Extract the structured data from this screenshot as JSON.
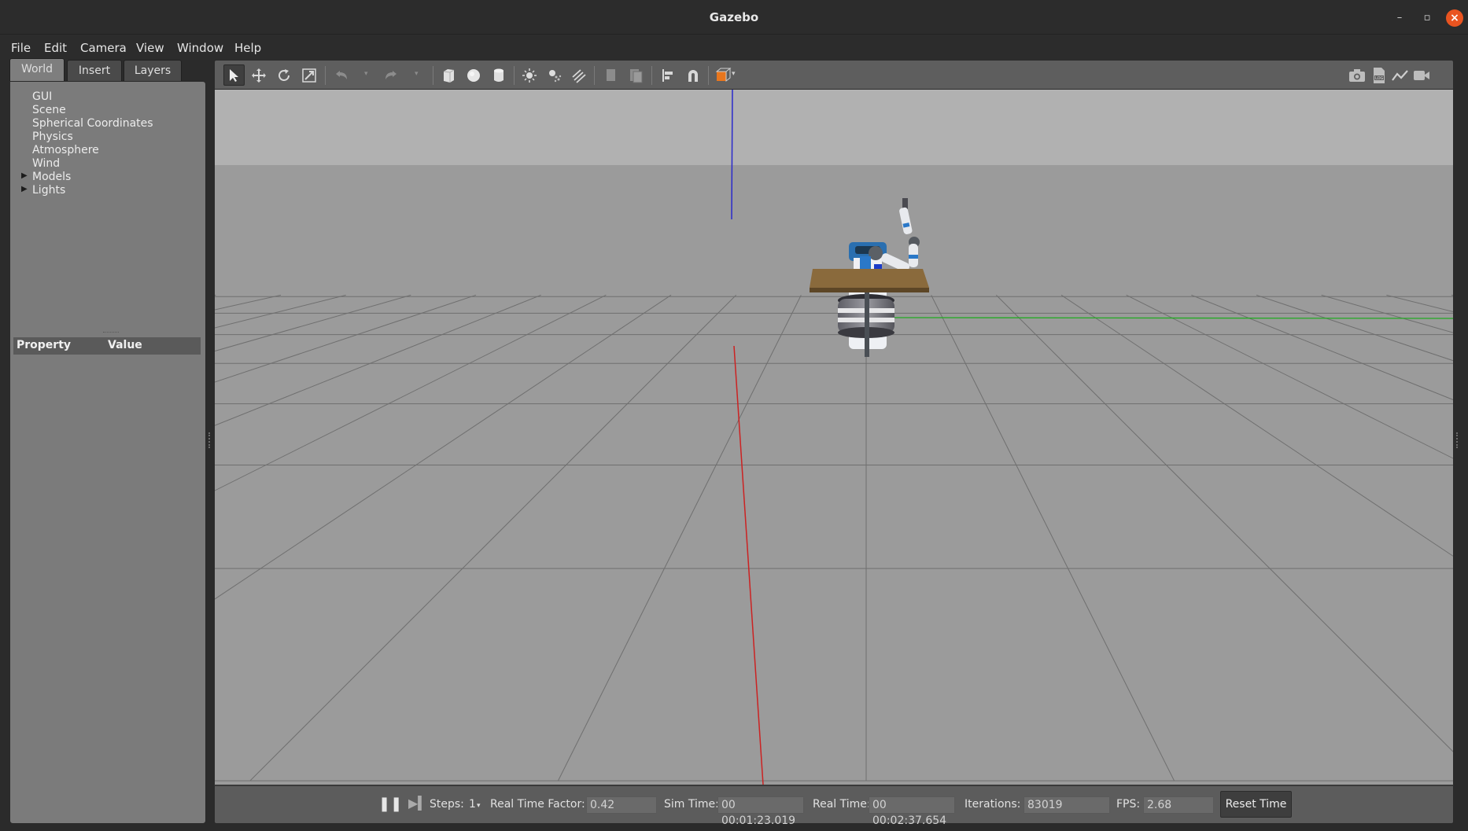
{
  "window": {
    "title": "Gazebo"
  },
  "menu": [
    {
      "label": "File",
      "accel": "F"
    },
    {
      "label": "Edit",
      "accel": "E"
    },
    {
      "label": "Camera",
      "accel": "C"
    },
    {
      "label": "View",
      "accel": "V"
    },
    {
      "label": "Window",
      "accel": "W"
    },
    {
      "label": "Help",
      "accel": "H"
    }
  ],
  "left_panel": {
    "tabs": [
      {
        "label": "World",
        "active": true
      },
      {
        "label": "Insert",
        "active": false
      },
      {
        "label": "Layers",
        "active": false
      }
    ],
    "tree": [
      {
        "label": "GUI",
        "expandable": false
      },
      {
        "label": "Scene",
        "expandable": false
      },
      {
        "label": "Spherical Coordinates",
        "expandable": false
      },
      {
        "label": "Physics",
        "expandable": false
      },
      {
        "label": "Atmosphere",
        "expandable": false
      },
      {
        "label": "Wind",
        "expandable": false
      },
      {
        "label": "Models",
        "expandable": true
      },
      {
        "label": "Lights",
        "expandable": true
      }
    ],
    "property_header": {
      "property": "Property",
      "value": "Value"
    }
  },
  "toolbar": {
    "tools": [
      "select-mode-icon",
      "translate-mode-icon",
      "rotate-mode-icon",
      "scale-mode-icon",
      "undo-icon",
      "redo-icon",
      "box-shape-icon",
      "sphere-shape-icon",
      "cylinder-shape-icon",
      "point-light-icon",
      "spot-light-icon",
      "directional-light-icon",
      "copy-icon",
      "paste-icon",
      "align-icon",
      "snap-icon",
      "view-angle-icon"
    ],
    "right_tools": [
      "screenshot-icon",
      "log-icon",
      "plot-icon",
      "video-record-icon"
    ]
  },
  "status_bar": {
    "steps_label": "Steps:",
    "steps_value": "1",
    "rtf_label": "Real Time Factor:",
    "rtf_value": "0.42",
    "sim_time_label": "Sim Time:",
    "sim_time_value": "00 00:01:23.019",
    "real_time_label": "Real Time:",
    "real_time_value": "00 00:02:37.654",
    "iterations_label": "Iterations:",
    "iterations_value": "83019",
    "fps_label": "FPS:",
    "fps_value": "2.68",
    "reset_button": "Reset Time"
  },
  "colors": {
    "close_button": "#e95420",
    "x_axis": "#cc2222",
    "y_axis": "#22aa22",
    "z_axis": "#2222cc",
    "table_top": "#8a6a3c"
  }
}
